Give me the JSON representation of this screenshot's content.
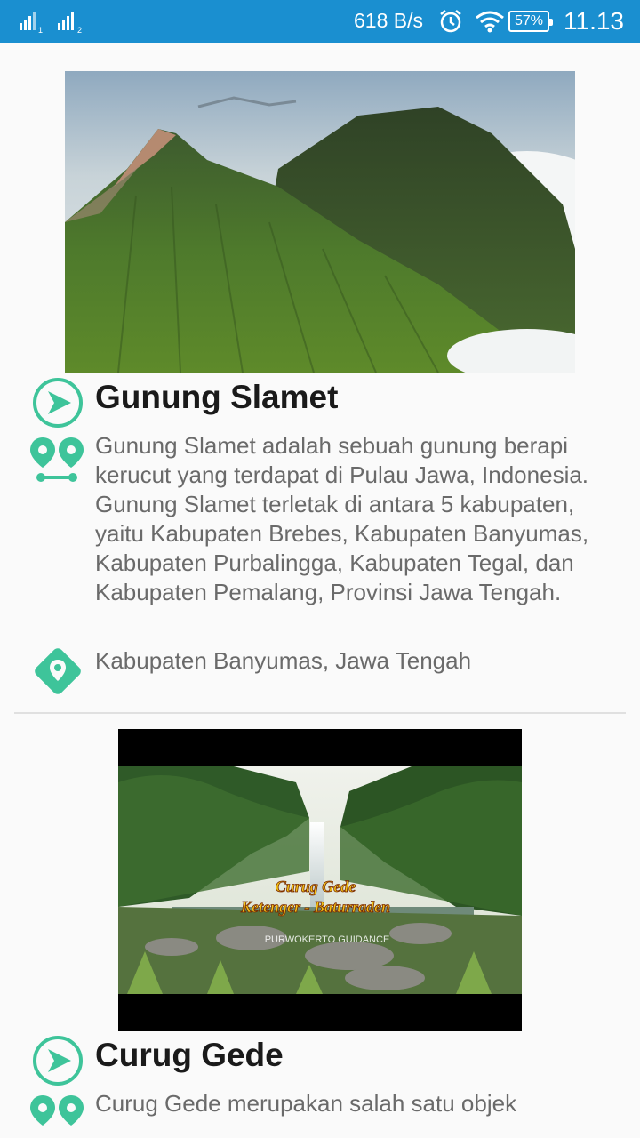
{
  "status_bar": {
    "speed": "618 B/s",
    "battery": "57%",
    "time": "11.13"
  },
  "places": [
    {
      "title": "Gunung Slamet",
      "description": "Gunung Slamet adalah sebuah gunung berapi kerucut yang terdapat di Pulau Jawa, Indonesia. Gunung Slamet terletak di antara 5 kabupaten, yaitu Kabupaten Brebes, Kabupaten Banyumas, Kabupaten Purbalingga, Kabupaten Tegal, dan Kabupaten Pemalang, Provinsi Jawa Tengah.",
      "location": "Kabupaten Banyumas, Jawa Tengah"
    },
    {
      "title": "Curug Gede",
      "description": "Curug Gede merupakan salah satu objek",
      "image_caption_line1": "Curug Gede",
      "image_caption_line2": "Ketenger - Baturraden",
      "image_watermark": "PURWOKERTO GUIDANCE"
    }
  ],
  "colors": {
    "status_bar": "#1a8fd0",
    "accent_teal": "#3ec49a"
  },
  "icons": [
    "signal-icon",
    "alarm-icon",
    "wifi-icon",
    "battery-icon",
    "navigate-icon",
    "route-icon",
    "location-pin-icon"
  ]
}
